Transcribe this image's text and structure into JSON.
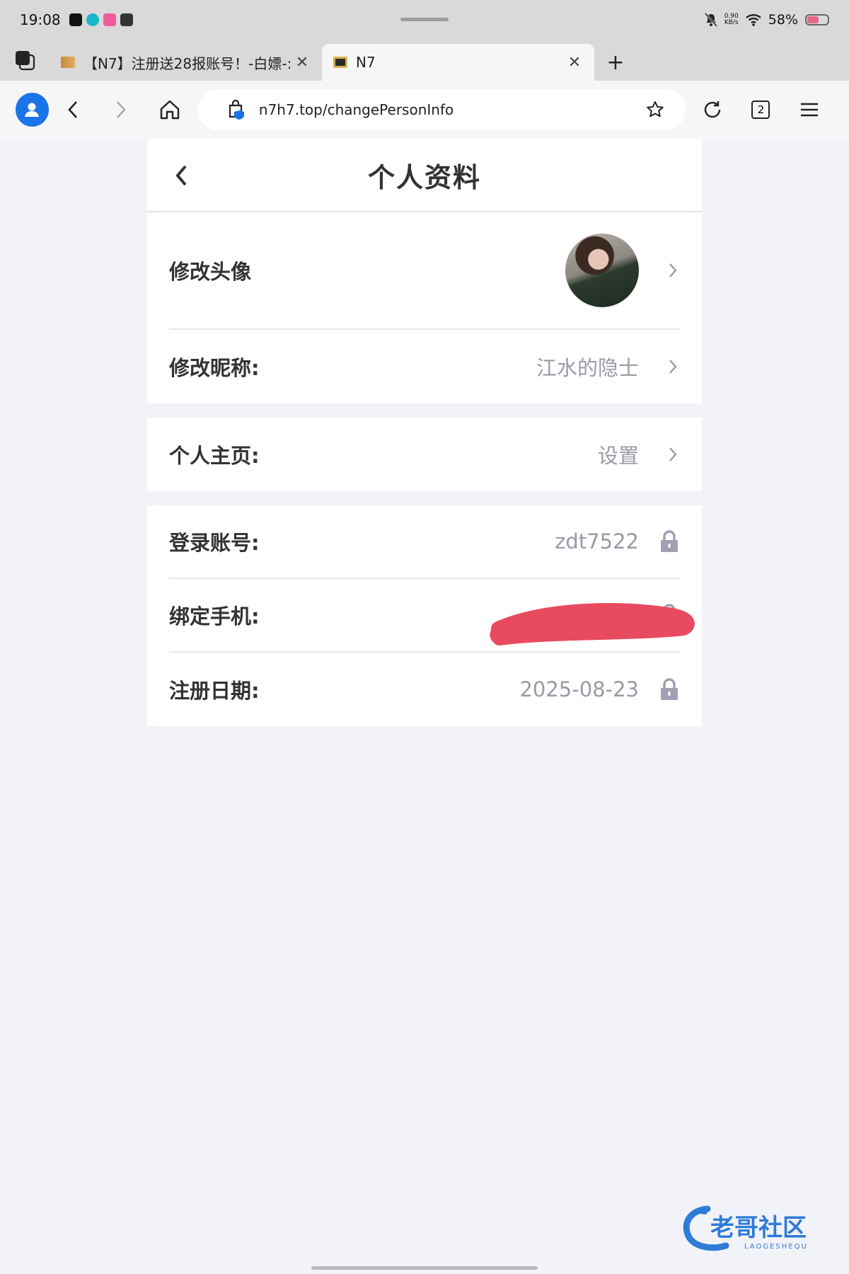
{
  "status_bar": {
    "time": "19:08",
    "net_speed_value": "0.90",
    "net_speed_unit": "KB/s",
    "battery": "58%",
    "battery_level": 0.58
  },
  "tabs": [
    {
      "title": "【N7】注册送28报账号！-白嫖-:",
      "active": false
    },
    {
      "title": "N7",
      "active": true
    }
  ],
  "toolbar": {
    "url": "n7h7.top/changePersonInfo",
    "tab_count": "2"
  },
  "page": {
    "title": "个人资料",
    "rows": {
      "avatar": {
        "label": "修改头像"
      },
      "nickname": {
        "label": "修改昵称:",
        "value": "江水的隐士"
      },
      "homepage": {
        "label": "个人主页:",
        "value": "设置"
      },
      "account": {
        "label": "登录账号:",
        "value": "zdt7522"
      },
      "phone": {
        "label": "绑定手机:",
        "value": ""
      },
      "register_date": {
        "label": "注册日期:",
        "value": "2025-08-23"
      }
    }
  },
  "watermark": {
    "text": "老哥社区",
    "subtext": "LAOGESHEQU"
  },
  "colors": {
    "accent": "#1a73e8",
    "page_bg": "#f2f3f8",
    "muted_text": "#999aa6",
    "lock": "#9fa0b3",
    "redaction": "#e84a5f"
  }
}
